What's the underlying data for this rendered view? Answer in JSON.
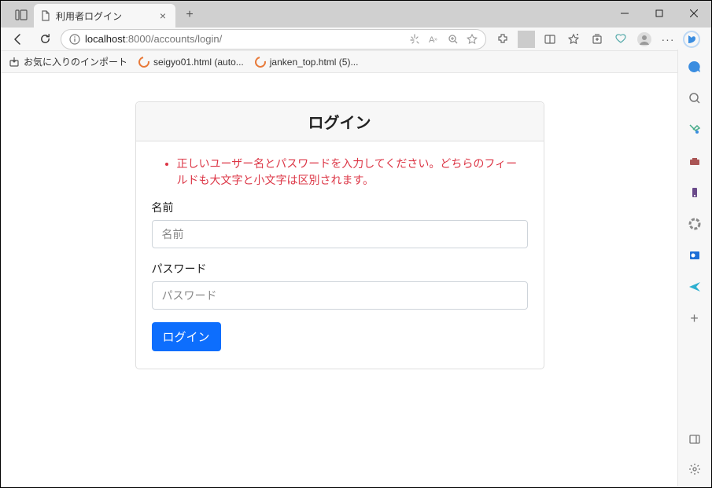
{
  "browser": {
    "tab_title": "利用者ログイン",
    "url_prefix": "localhost",
    "url_port_path": ":8000/accounts/login/",
    "bookmarks": {
      "import_label": "お気に入りのインポート",
      "item1": "seigyo01.html (auto...",
      "item2": "janken_top.html (5)..."
    }
  },
  "login": {
    "card_title": "ログイン",
    "error_message": "正しいユーザー名とパスワードを入力してください。どちらのフィールドも大文字と小文字は区別されます。",
    "name_label": "名前",
    "name_placeholder": "名前",
    "password_label": "パスワード",
    "password_placeholder": "パスワード",
    "submit_label": "ログイン"
  }
}
